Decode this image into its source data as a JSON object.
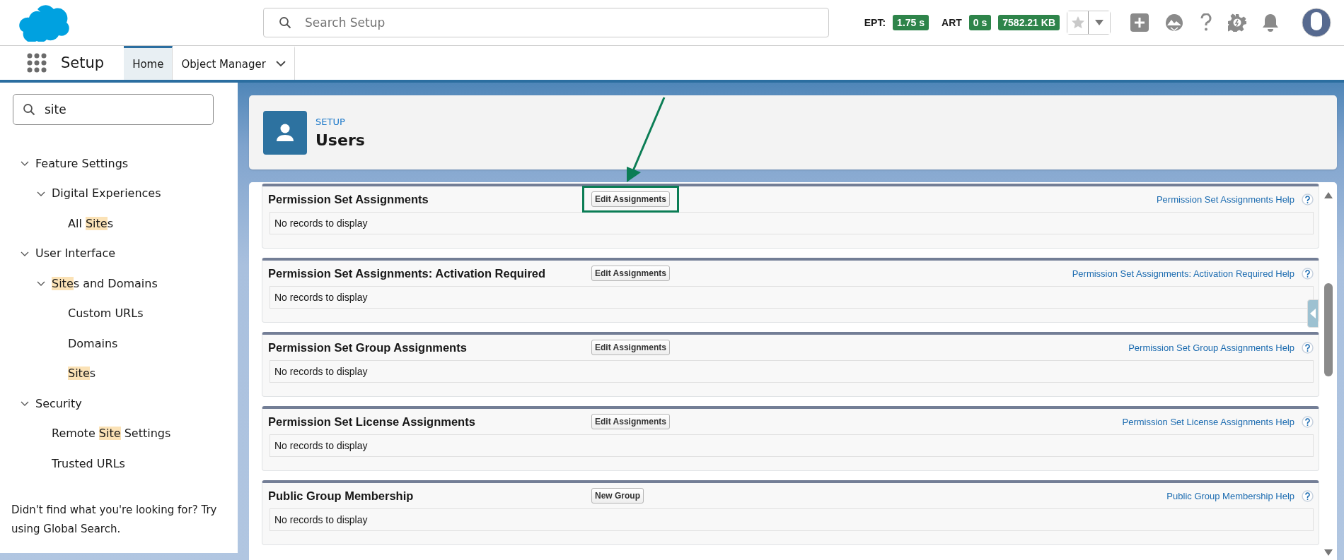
{
  "header": {
    "search": {
      "placeholder": "Search Setup"
    },
    "metrics": [
      {
        "label": "EPT:",
        "value": "1.75 s"
      },
      {
        "label": "ART",
        "value": "0 s"
      },
      {
        "value": "7582.21 KB"
      }
    ]
  },
  "nav": {
    "app_name": "Setup",
    "tabs": [
      {
        "label": "Home",
        "selected": true,
        "dropdown": false
      },
      {
        "label": "Object Manager",
        "selected": false,
        "dropdown": true
      }
    ]
  },
  "sidebar": {
    "search": {
      "value": "site"
    },
    "tree": [
      {
        "label_parts": [
          {
            "text": "Feature Settings",
            "highlighted": false
          }
        ],
        "expanded": true,
        "children": [
          {
            "label_parts": [
              {
                "text": "Digital Experiences",
                "highlighted": false
              }
            ],
            "expanded": true,
            "children": [
              {
                "label_parts": [
                  {
                    "text": "All ",
                    "highlighted": false
                  },
                  {
                    "text": "Site",
                    "highlighted": true
                  },
                  {
                    "text": "s",
                    "highlighted": false
                  }
                ]
              }
            ]
          }
        ]
      },
      {
        "label_parts": [
          {
            "text": "User Interface",
            "highlighted": false
          }
        ],
        "expanded": true,
        "children": [
          {
            "label_parts": [
              {
                "text": "Site",
                "highlighted": true
              },
              {
                "text": "s and Domains",
                "highlighted": false
              }
            ],
            "expanded": true,
            "children": [
              {
                "label_parts": [
                  {
                    "text": "Custom URLs",
                    "highlighted": false
                  }
                ]
              },
              {
                "label_parts": [
                  {
                    "text": "Domains",
                    "highlighted": false
                  }
                ]
              },
              {
                "label_parts": [
                  {
                    "text": "Site",
                    "highlighted": true
                  },
                  {
                    "text": "s",
                    "highlighted": false
                  }
                ]
              }
            ]
          }
        ]
      },
      {
        "label_parts": [
          {
            "text": "Security",
            "highlighted": false
          }
        ],
        "expanded": true,
        "children": [
          {
            "label_parts": [
              {
                "text": "Remote ",
                "highlighted": false
              },
              {
                "text": "Site",
                "highlighted": true
              },
              {
                "text": " Settings",
                "highlighted": false
              }
            ]
          },
          {
            "label_parts": [
              {
                "text": "Trusted URLs",
                "highlighted": false
              }
            ]
          }
        ]
      }
    ],
    "footer": "Didn't find what you're looking for? Try using Global Search."
  },
  "page_header": {
    "breadcrumb": "SETUP",
    "title": "Users"
  },
  "sections": [
    {
      "title": "Permission Set Assignments",
      "button": "Edit Assignments",
      "help": "Permission Set Assignments Help",
      "empty_text": "No records to display",
      "highlighted": true
    },
    {
      "title": "Permission Set Assignments: Activation Required",
      "button": "Edit Assignments",
      "help": "Permission Set Assignments: Activation Required Help",
      "empty_text": "No records to display",
      "highlighted": false
    },
    {
      "title": "Permission Set Group Assignments",
      "button": "Edit Assignments",
      "help": "Permission Set Group Assignments Help",
      "empty_text": "No records to display",
      "highlighted": false
    },
    {
      "title": "Permission Set License Assignments",
      "button": "Edit Assignments",
      "help": "Permission Set License Assignments Help",
      "empty_text": "No records to display",
      "highlighted": false
    },
    {
      "title": "Public Group Membership",
      "button": "New Group",
      "help": "Public Group Membership Help",
      "empty_text": "No records to display",
      "highlighted": false
    }
  ]
}
